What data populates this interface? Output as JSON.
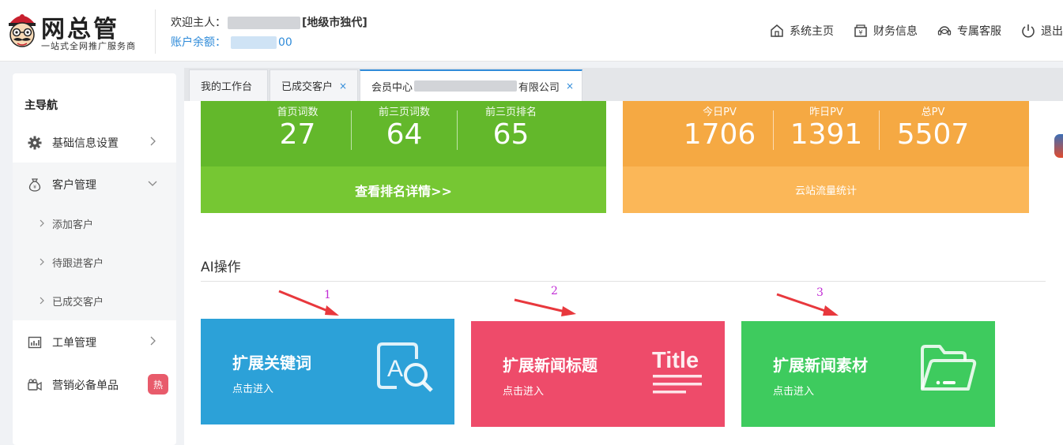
{
  "header": {
    "logo_title": "网总管",
    "logo_subtitle": "一站式全网推广服务商",
    "welcome_prefix": "欢迎主人：",
    "welcome_role": "[地级市独代]",
    "balance_label": "账户余额：",
    "balance_suffix": "00",
    "nav": [
      {
        "label": "系统主页",
        "icon": "home-icon"
      },
      {
        "label": "财务信息",
        "icon": "finance-icon"
      },
      {
        "label": "专属客服",
        "icon": "headset-icon"
      },
      {
        "label": "退出",
        "icon": "power-icon"
      }
    ]
  },
  "sidebar": {
    "title": "主导航",
    "items": [
      {
        "label": "基础信息设置",
        "icon": "gear-icon"
      },
      {
        "label": "客户管理",
        "icon": "money-bag-icon"
      },
      {
        "label": "工单管理",
        "icon": "chart-icon"
      },
      {
        "label": "营销必备单品",
        "icon": "camera-icon",
        "badge": "热"
      }
    ],
    "sub_items": [
      {
        "label": "添加客户"
      },
      {
        "label": "待跟进客户"
      },
      {
        "label": "已成交客户"
      }
    ]
  },
  "tabs": [
    {
      "label": "我的工作台"
    },
    {
      "label": "已成交客户",
      "close": "×"
    },
    {
      "label_prefix": "会员中心",
      "label_suffix": "有限公司",
      "close": "×"
    }
  ],
  "stats": {
    "green": {
      "columns": [
        {
          "label": "首页词数",
          "value": "27"
        },
        {
          "label": "前三页词数",
          "value": "64"
        },
        {
          "label": "前三页排名",
          "value": "65"
        }
      ],
      "footer": "查看排名详情>>",
      "color_top": "#63b82b",
      "color_bottom": "#76c733"
    },
    "orange": {
      "columns": [
        {
          "label": "今日PV",
          "value": "1706"
        },
        {
          "label": "昨日PV",
          "value": "1391"
        },
        {
          "label": "总PV",
          "value": "5507"
        }
      ],
      "footer": "云站流量统计",
      "color_top": "#f5a943",
      "color_bottom": "#fbb758"
    }
  },
  "ai_section": {
    "title": "AI操作",
    "cards": [
      {
        "title": "扩展关键词",
        "subtitle": "点击进入",
        "icon": "search-document-icon",
        "color": "#2ca1d8",
        "marker": "1"
      },
      {
        "title": "扩展新闻标题",
        "subtitle": "点击进入",
        "icon": "title-icon",
        "icon_text": "Title",
        "color": "#ee4b6a",
        "marker": "2"
      },
      {
        "title": "扩展新闻素材",
        "subtitle": "点击进入",
        "icon": "folder-icon",
        "color": "#3ecb5e",
        "marker": "3"
      }
    ]
  }
}
